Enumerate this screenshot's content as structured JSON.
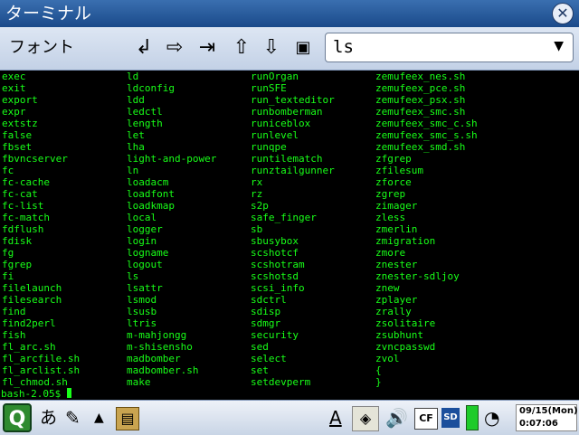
{
  "window": {
    "title": "ターミナル",
    "close_icon": "close-icon"
  },
  "toolbar": {
    "font_label": "フォント",
    "buttons": [
      {
        "name": "return-icon",
        "glyph": "↲"
      },
      {
        "name": "tab-right-icon",
        "glyph": "⇨"
      },
      {
        "name": "tab-end-icon",
        "glyph": "⇥"
      },
      {
        "name": "arrow-up-icon",
        "glyph": "⇧"
      },
      {
        "name": "arrow-down-icon",
        "glyph": "⇩"
      },
      {
        "name": "paste-icon",
        "glyph": "📋"
      }
    ],
    "command_value": "ls"
  },
  "terminal": {
    "columns": [
      [
        "exec",
        "exit",
        "export",
        "expr",
        "extstz",
        "false",
        "fbset",
        "fbvncserver",
        "fc",
        "fc-cache",
        "fc-cat",
        "fc-list",
        "fc-match",
        "fdflush",
        "fdisk",
        "fg",
        "fgrep",
        "fi",
        "filelaunch",
        "filesearch",
        "find",
        "find2perl",
        "fish",
        "fl_arc.sh",
        "fl_arcfile.sh",
        "fl_arclist.sh",
        "fl_chmod.sh"
      ],
      [
        "ld",
        "ldconfig",
        "ldd",
        "ledctl",
        "length",
        "let",
        "lha",
        "light-and-power",
        "ln",
        "loadacm",
        "loadfont",
        "loadkmap",
        "local",
        "logger",
        "login",
        "logname",
        "logout",
        "ls",
        "lsattr",
        "lsmod",
        "lsusb",
        "ltris",
        "m-mahjongg",
        "m-shisensho",
        "madbomber",
        "madbomber.sh",
        "make"
      ],
      [
        "runOrgan",
        "runSFE",
        "run_texteditor",
        "runbomberman",
        "runiceblox",
        "runlevel",
        "runqpe",
        "runtilematch",
        "runztailgunner",
        "rx",
        "rz",
        "s2p",
        "safe_finger",
        "sb",
        "sbusybox",
        "scshotcf",
        "scshotram",
        "scshotsd",
        "scsi_info",
        "sdctrl",
        "sdisp",
        "sdmgr",
        "security",
        "sed",
        "select",
        "set",
        "setdevperm"
      ],
      [
        "zemufeex_nes.sh",
        "zemufeex_pce.sh",
        "zemufeex_psx.sh",
        "zemufeex_smc.sh",
        "zemufeex_smc_c.sh",
        "zemufeex_smc_s.sh",
        "zemufeex_smd.sh",
        "zfgrep",
        "zfilesum",
        "zforce",
        "zgrep",
        "zimager",
        "zless",
        "zmerlin",
        "zmigration",
        "zmore",
        "znester",
        "znester-sdljoy",
        "znew",
        "zplayer",
        "zrally",
        "zsolitaire",
        "zsubhunt",
        "zvncpasswd",
        "zvol",
        "{",
        "}"
      ]
    ],
    "prompt": "bash-2.05$ "
  },
  "taskbar": {
    "launcher_letter": "Q",
    "input_method": "あ",
    "items": [
      "pen-icon",
      "up-triangle-icon",
      "document-icon",
      "text-input-icon",
      "network-icon",
      "volume-icon",
      "cf-card-icon",
      "sd-card-icon",
      "battery-icon",
      "mouse-icon"
    ],
    "item_glyphs": [
      "✎",
      "▲",
      "▤",
      "A",
      "◈",
      "🔊",
      "CF",
      "SD",
      "▮",
      "◔"
    ],
    "clock_date": "09/15(Mon)",
    "clock_time": "0:07:06"
  },
  "colors": {
    "terminal_text": "#18ff18",
    "terminal_bg": "#000000",
    "title_bar": "#1a4a8a"
  }
}
